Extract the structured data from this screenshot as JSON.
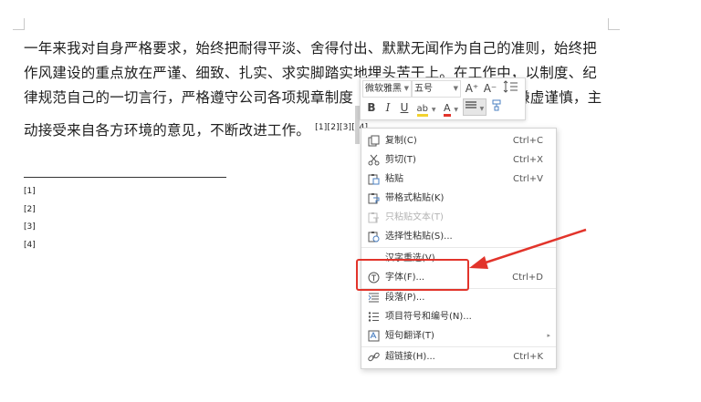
{
  "document": {
    "lines": [
      "一年来我对自身严格要求，始终把耐得平淡、舍得付出、默默无闻作为自己的准则，始终把",
      "作风建设的重点放在严谨、细致、扎实、求实脚踏实地埋头苦干上。在工作中，以制度、纪",
      "律规范自己的一切言行，严格遵守公司各项规章制度",
      "动接受来自各方环境的意见，不断改进工作。"
    ],
    "line3_tail": "谦虚谨慎，主",
    "footnote_refs": "[1][2][3][_4]",
    "footnotes": [
      "[1]",
      "[2]",
      "[3]",
      "[4]"
    ]
  },
  "mini_toolbar": {
    "font_name": "微软雅黑",
    "font_size": "五号",
    "grow_font_label": "A⁺",
    "shrink_font_label": "A⁻",
    "bold_label": "B",
    "italic_label": "I",
    "underline_label": "U",
    "highlight_label": "ab",
    "font_color_label": "A",
    "highlight_color": "#f2d22e",
    "font_color": "#e2342b"
  },
  "context_menu": {
    "items": [
      {
        "label": "复制(C)",
        "shortcut": "Ctrl+C",
        "icon": "copy-icon",
        "disabled": false
      },
      {
        "label": "剪切(T)",
        "shortcut": "Ctrl+X",
        "icon": "cut-icon",
        "disabled": false
      },
      {
        "label": "粘贴",
        "shortcut": "Ctrl+V",
        "icon": "paste-icon",
        "disabled": false
      },
      {
        "label": "带格式粘贴(K)",
        "shortcut": "",
        "icon": "paste-format-icon",
        "disabled": false
      },
      {
        "label": "只粘贴文本(T)",
        "shortcut": "",
        "icon": "paste-text-icon",
        "disabled": true
      },
      {
        "label": "选择性粘贴(S)...",
        "shortcut": "",
        "icon": "paste-special-icon",
        "disabled": false
      },
      {
        "label": "汉字重选(V)",
        "shortcut": "",
        "icon": "",
        "disabled": false
      },
      {
        "label": "字体(F)...",
        "shortcut": "Ctrl+D",
        "icon": "font-icon",
        "disabled": false
      },
      {
        "label": "段落(P)...",
        "shortcut": "",
        "icon": "paragraph-icon",
        "disabled": false
      },
      {
        "label": "项目符号和编号(N)...",
        "shortcut": "",
        "icon": "bullets-icon",
        "disabled": false
      },
      {
        "label": "短句翻译(T)",
        "shortcut": "",
        "icon": "translate-icon",
        "disabled": false
      },
      {
        "label": "超链接(H)...",
        "shortcut": "Ctrl+K",
        "icon": "link-icon",
        "disabled": false
      }
    ]
  },
  "annotation_color": "#e2342b"
}
